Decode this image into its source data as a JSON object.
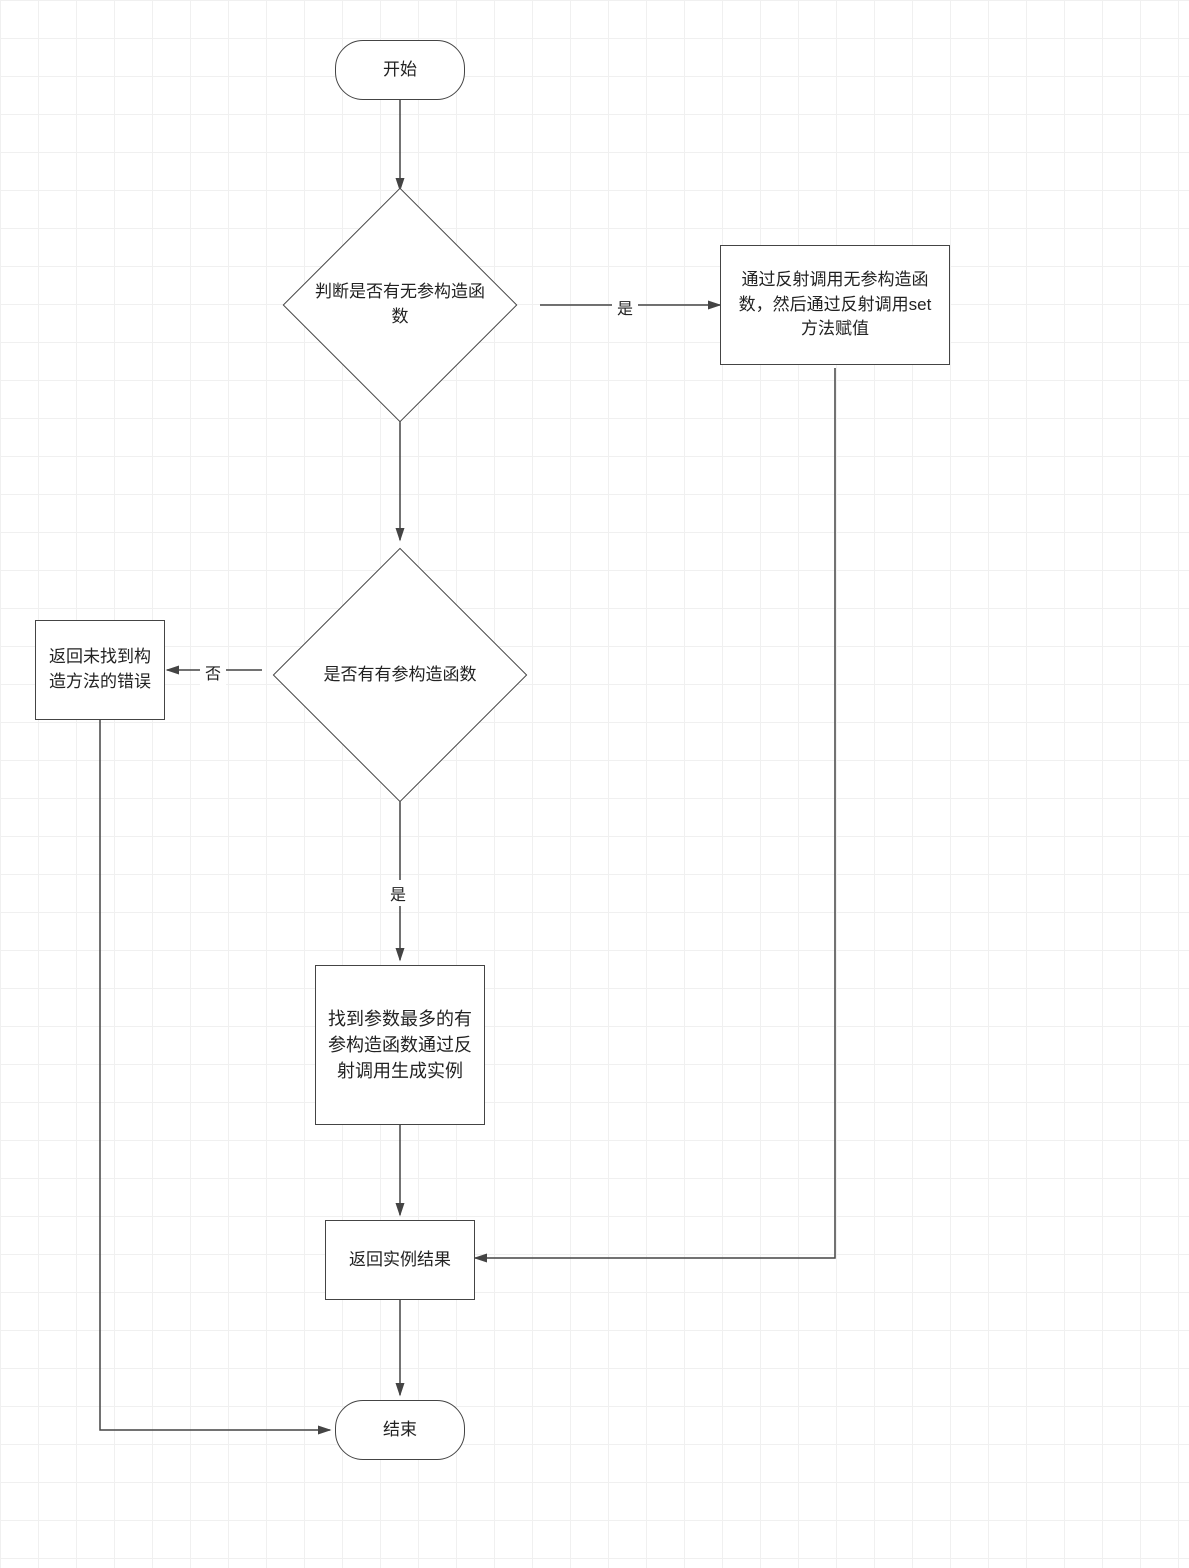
{
  "nodes": {
    "start": "开始",
    "decision1": "判断是否有无参构造函数",
    "process_right": "通过反射调用无参构造函数，然后通过反射调用set方法赋值",
    "decision2": "是否有有参构造函数",
    "process_left": "返回未找到构造方法的错误",
    "process_mid": "找到参数最多的有参构造函数通过反射调用生成实例",
    "result": "返回实例结果",
    "end": "结束"
  },
  "edges": {
    "yes1": "是",
    "no2": "否",
    "yes2": "是"
  }
}
